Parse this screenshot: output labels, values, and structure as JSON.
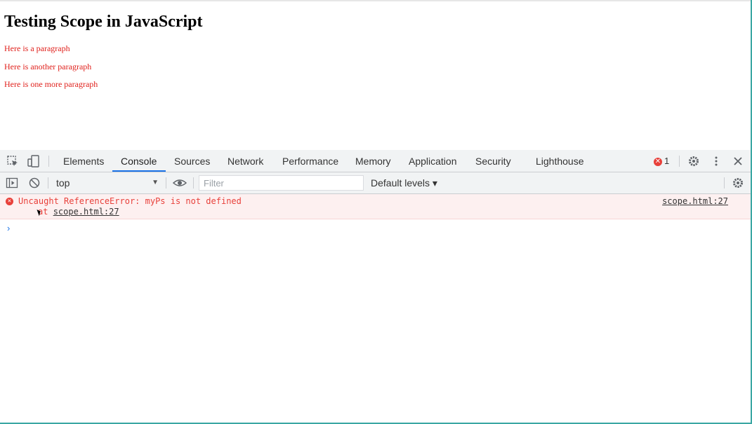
{
  "page": {
    "title": "Testing Scope in JavaScript",
    "paragraphs": [
      "Here is a paragraph",
      "Here is another paragraph",
      "Here is one more paragraph"
    ]
  },
  "devtools": {
    "tabs": [
      "Elements",
      "Console",
      "Sources",
      "Network",
      "Performance",
      "Memory",
      "Application",
      "Security",
      "Lighthouse"
    ],
    "active_tab": "Console",
    "error_count": "1",
    "toolbar": {
      "context": "top",
      "filter_placeholder": "Filter",
      "levels": "Default levels ▾"
    },
    "console": {
      "error_message": "Uncaught ReferenceError: myPs is not defined",
      "stack_prefix": "at ",
      "stack_link": "scope.html:27",
      "source_link": "scope.html:27",
      "prompt": "›"
    }
  },
  "colors": {
    "error": "#e8403a",
    "accent": "#1a73e8",
    "paragraph": "#e0201b"
  },
  "icons": [
    "inspect-element-icon",
    "device-toolbar-icon",
    "gear-icon",
    "more-vert-icon",
    "close-icon",
    "sidebar-toggle-icon",
    "clear-console-icon",
    "eye-icon",
    "error-icon"
  ]
}
